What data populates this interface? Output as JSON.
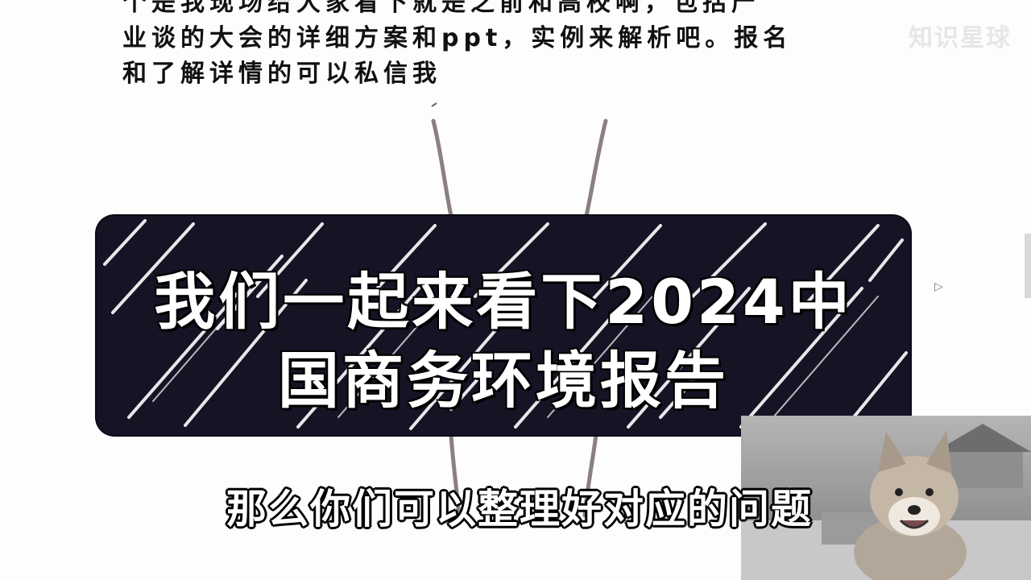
{
  "note": {
    "lines": [
      "个是我现场给大家看下就是之前和高校啊，包括产",
      "业谈的大会的详细方案和ppt，实例来解析吧。报名",
      "和了解详情的可以私信我"
    ]
  },
  "watermark": "知识星球",
  "banner": {
    "line1": "我们一起来看下2024中",
    "line2": "国商务环境报告"
  },
  "subtitle": "那么你们可以整理好对应的问题",
  "colors": {
    "banner_bg": "#141425",
    "banner_text": "#ffffff",
    "note_text": "#111111"
  }
}
